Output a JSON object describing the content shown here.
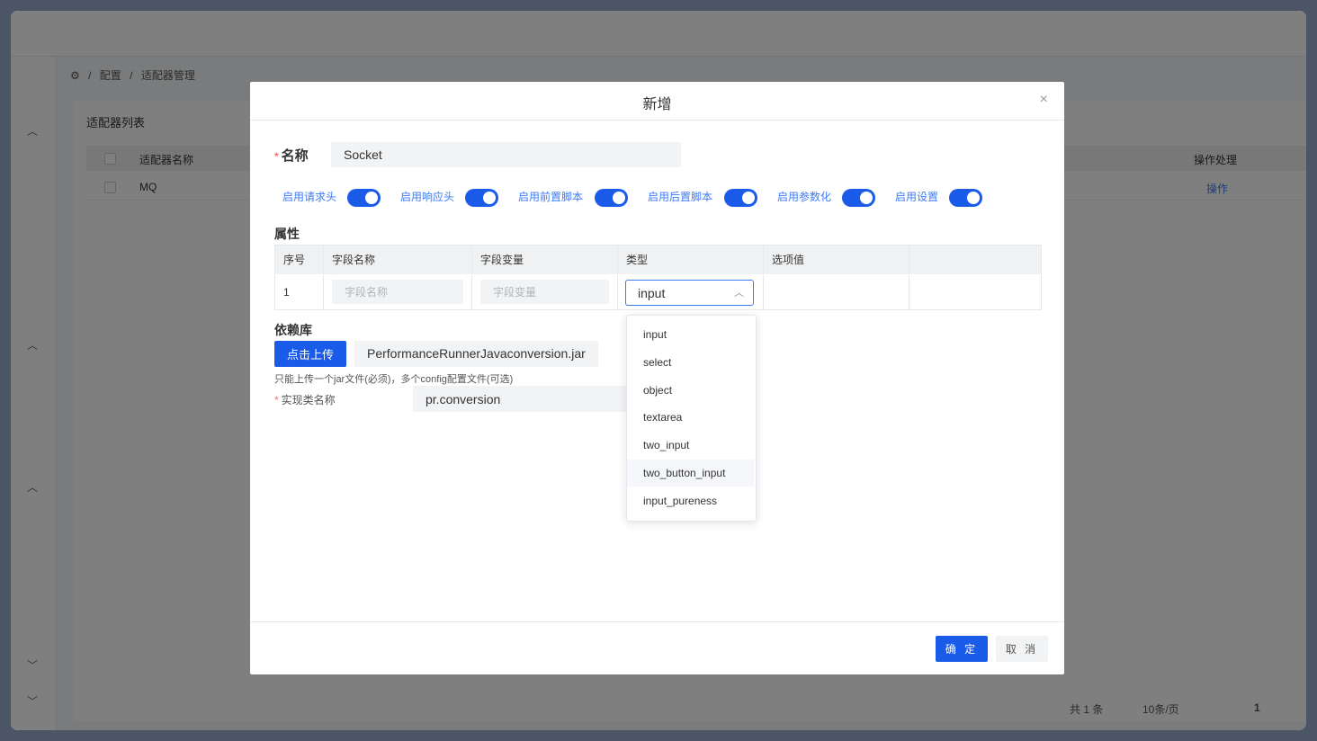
{
  "breadcrumb": {
    "item1": "配置",
    "sep": "/",
    "item2": "适配器管理"
  },
  "background_panel": {
    "title": "适配器列表",
    "columns": [
      "适配器名称",
      "操作处理"
    ],
    "rows": [
      {
        "name": "MQ",
        "action": "操作"
      }
    ],
    "pager": {
      "total": "共 1 条",
      "page_size": "10条/页",
      "page": "1"
    }
  },
  "modal": {
    "title": "新增",
    "close": "×",
    "name_label": "名称",
    "name_value": "Socket",
    "toggles": [
      {
        "label": "启用请求头",
        "on": true
      },
      {
        "label": "启用响应头",
        "on": true
      },
      {
        "label": "启用前置脚本",
        "on": true
      },
      {
        "label": "启用后置脚本",
        "on": true
      },
      {
        "label": "启用参数化",
        "on": true
      },
      {
        "label": "启用设置",
        "on": true
      }
    ],
    "attributes_title": "属性",
    "attributes_table": {
      "headers": [
        "序号",
        "字段名称",
        "字段变量",
        "类型",
        "选项值",
        ""
      ],
      "row": {
        "index": "1",
        "field_name_placeholder": "字段名称",
        "field_var_placeholder": "字段变量",
        "type_value": "input"
      }
    },
    "type_options": [
      "input",
      "select",
      "object",
      "textarea",
      "two_input",
      "two_button_input",
      "input_pureness"
    ],
    "hovered_option": "two_button_input",
    "deps_title": "依赖库",
    "upload_button": "点击上传",
    "file_name": "PerformanceRunnerJavaconversion.jar",
    "upload_hint": "只能上传一个jar文件(必须)，多个config配置文件(可选)",
    "impl_label": "实现类名称",
    "impl_value": "pr.conversion",
    "ok_button": "确 定",
    "cancel_button": "取 消"
  },
  "colors": {
    "primary": "#1a5bea",
    "link": "#3d7bf5",
    "required": "#f56c6c"
  }
}
